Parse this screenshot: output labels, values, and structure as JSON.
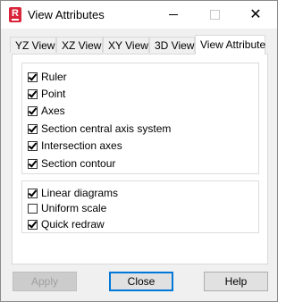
{
  "window": {
    "title": "View Attributes",
    "icon_letter": "R",
    "close_glyph": "✕"
  },
  "tabs": [
    {
      "label": "YZ View"
    },
    {
      "label": "XZ View"
    },
    {
      "label": "XY View"
    },
    {
      "label": "3D View"
    },
    {
      "label": "View Attribute",
      "active": true
    }
  ],
  "group1": [
    {
      "label": "Ruler",
      "checked": true
    },
    {
      "label": "Point",
      "checked": true
    },
    {
      "label": "Axes",
      "checked": true
    },
    {
      "label": "Section central axis system",
      "checked": true
    },
    {
      "label": "Intersection axes",
      "checked": true
    },
    {
      "label": "Section contour",
      "checked": true
    }
  ],
  "group2": [
    {
      "label": "Linear diagrams",
      "checked": true
    },
    {
      "label": "Uniform scale",
      "checked": false
    },
    {
      "label": "Quick redraw",
      "checked": true
    }
  ],
  "buttons": {
    "apply": "Apply",
    "close": "Close",
    "help": "Help"
  }
}
